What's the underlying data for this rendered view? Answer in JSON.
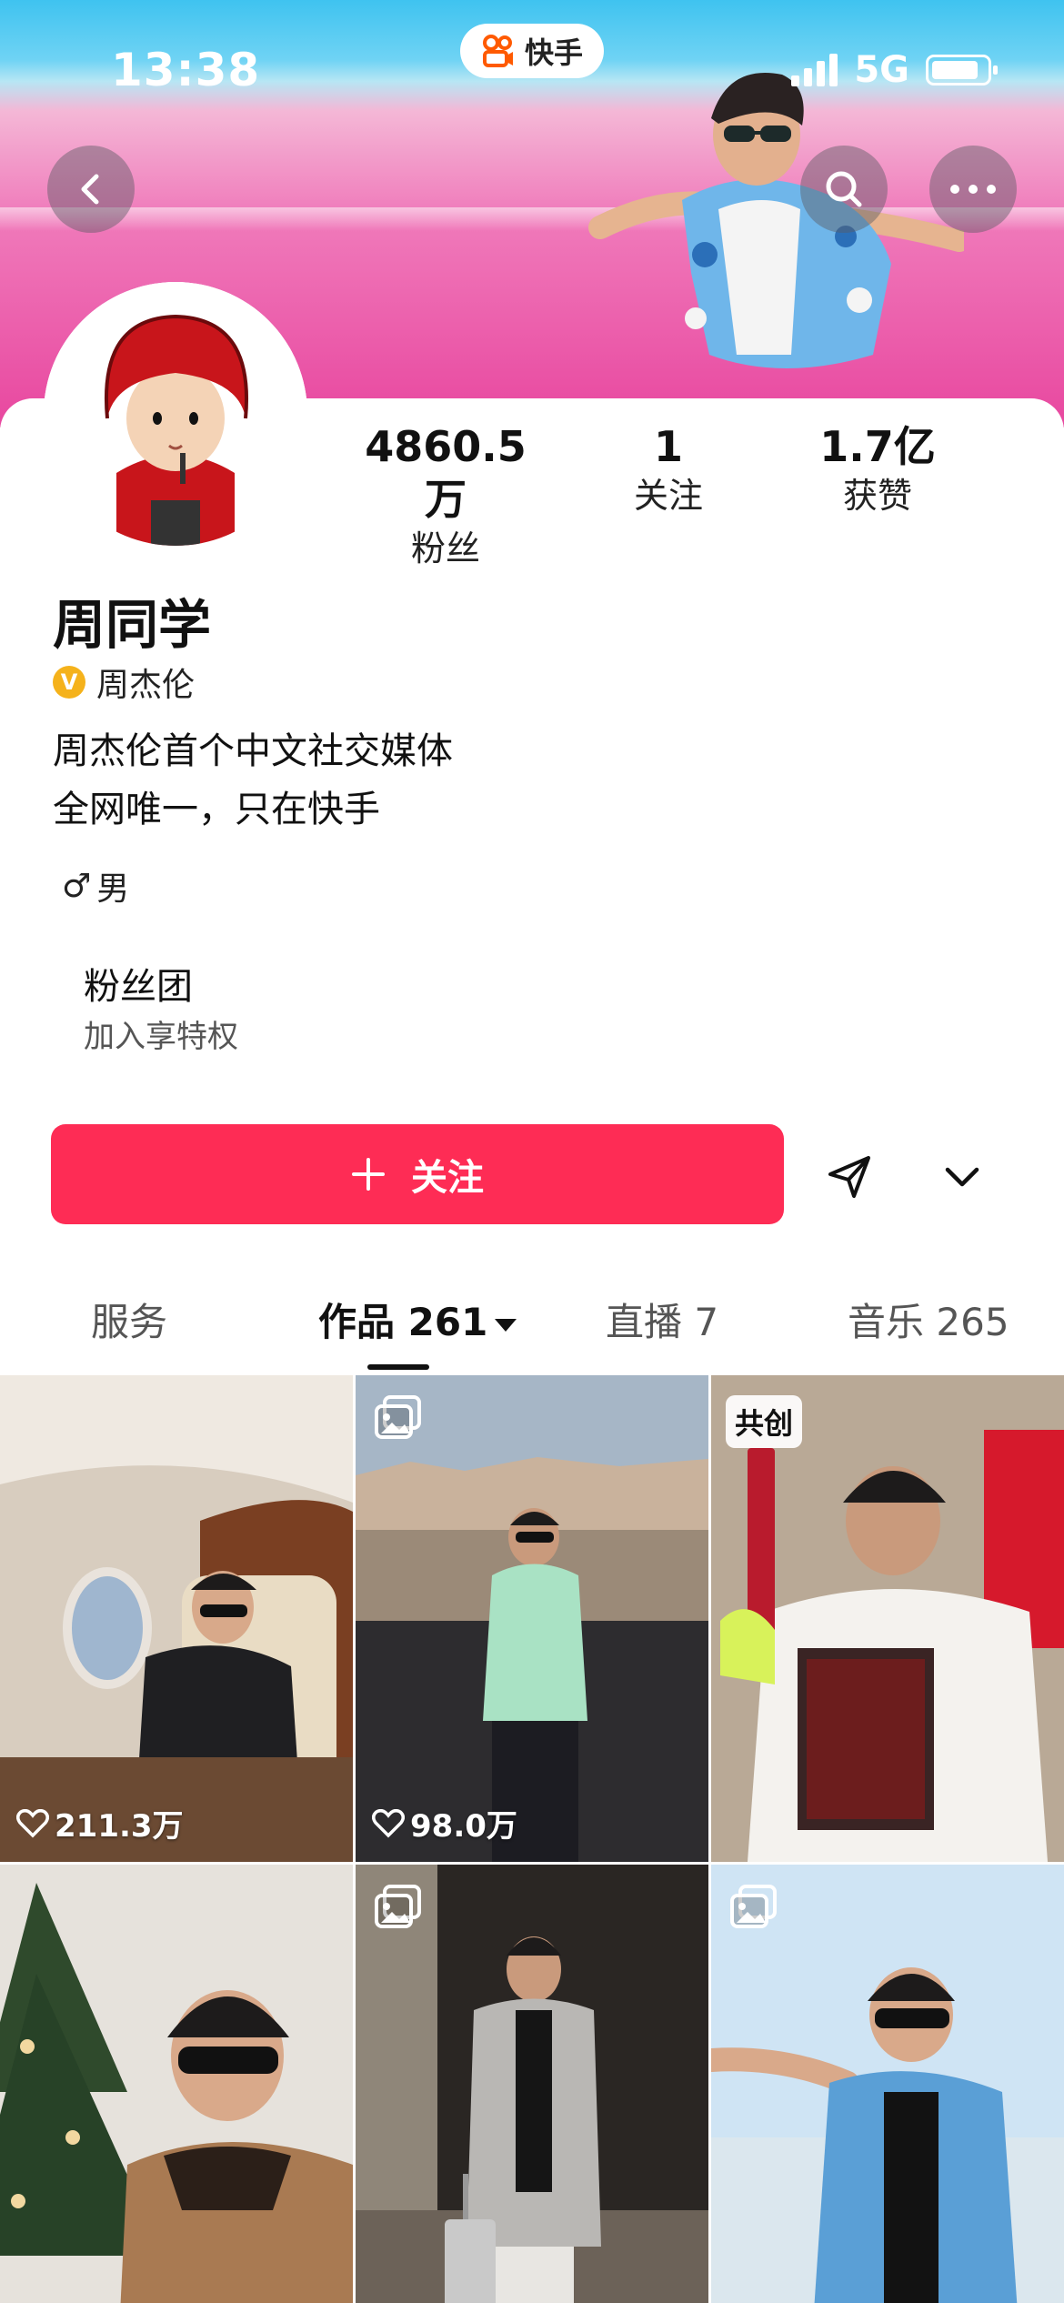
{
  "status_bar": {
    "time": "13:38",
    "network": "5G"
  },
  "app": {
    "name": "快手"
  },
  "profile": {
    "name": "周同学",
    "verified_name": "周杰伦",
    "verified_badge": "V",
    "bio_lines": [
      "周杰伦首个中文社交媒体",
      "全网唯一，只在快手"
    ],
    "gender": "男",
    "gender_symbol": "♂"
  },
  "stats": [
    {
      "value": "4860.5万",
      "label": "粉丝"
    },
    {
      "value": "1",
      "label": "关注"
    },
    {
      "value": "1.7亿",
      "label": "获赞"
    }
  ],
  "fan_group": {
    "title": "粉丝团",
    "subtitle": "加入享特权"
  },
  "actions": {
    "follow_label": "关注",
    "follow_icon": "plus-icon"
  },
  "tabs": [
    {
      "name": "服务",
      "count": ""
    },
    {
      "name": "作品",
      "count": "261"
    },
    {
      "name": "直播",
      "count": "7"
    },
    {
      "name": "音乐",
      "count": "265"
    }
  ],
  "grid": [
    {
      "likes": "211.3万",
      "badge": ""
    },
    {
      "likes": "98.0万",
      "badge": "gallery"
    },
    {
      "likes": "",
      "badge": "共创"
    },
    {
      "likes": "",
      "badge": ""
    },
    {
      "likes": "",
      "badge": "gallery"
    },
    {
      "likes": "",
      "badge": "gallery"
    }
  ],
  "colors": {
    "primary": "#fe2c55",
    "verified": "#f5b21b",
    "app_logo": "#ff5a00"
  }
}
